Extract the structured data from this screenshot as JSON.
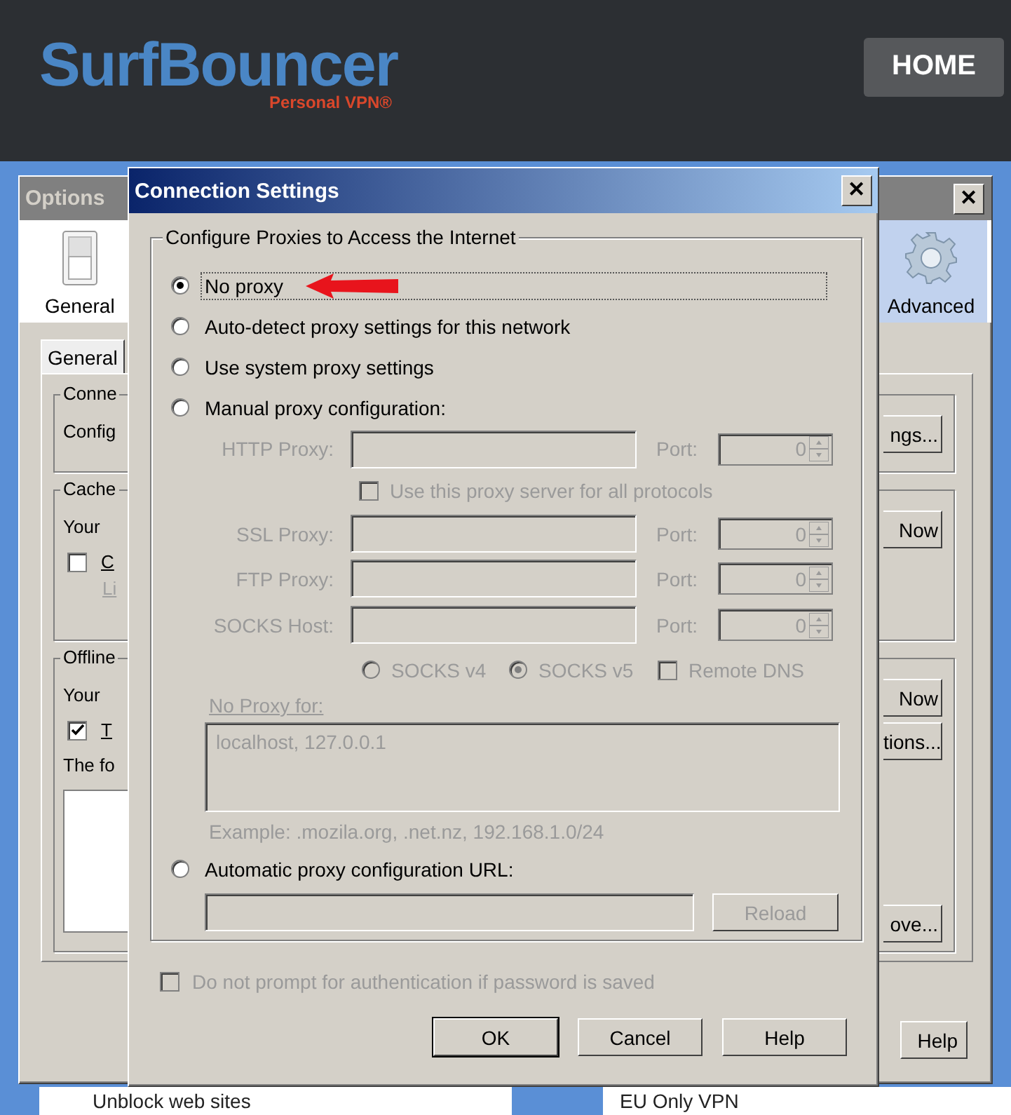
{
  "site": {
    "logo": "SurfBouncer",
    "tagline": "Personal VPN®",
    "home": "HOME"
  },
  "options_window": {
    "title": "Options",
    "close": "✕",
    "toolbar": [
      {
        "label": "General",
        "kind": "switch",
        "selected": false
      },
      {
        "label": "Advanced",
        "kind": "gear",
        "selected": true
      }
    ],
    "tabs": [
      {
        "label": "General",
        "selected": true
      }
    ],
    "groups": [
      {
        "title": "Conne",
        "lines": [
          {
            "kind": "text",
            "text": "Config"
          }
        ],
        "buttons": [
          "ngs..."
        ]
      },
      {
        "title": "Cache",
        "lines": [
          {
            "kind": "text",
            "text": "Your"
          },
          {
            "kind": "checkbox",
            "text": "C",
            "checked": false
          },
          {
            "kind": "link",
            "text": "Li"
          }
        ],
        "buttons": [
          "Now"
        ]
      },
      {
        "title": "Offline",
        "lines": [
          {
            "kind": "text",
            "text": "Your"
          },
          {
            "kind": "checkbox",
            "text": "T",
            "checked": true
          },
          {
            "kind": "text",
            "text": "The fo"
          },
          {
            "kind": "listbox"
          }
        ],
        "buttons": [
          "Now",
          "tions...",
          "ove..."
        ]
      }
    ],
    "help": "Help"
  },
  "dialog": {
    "title": "Connection Settings",
    "close": "✕",
    "group_title": "Configure Proxies to Access the Internet",
    "modes": [
      {
        "label": "No proxy",
        "selected": true
      },
      {
        "label": "Auto-detect proxy settings for this network",
        "selected": false
      },
      {
        "label": "Use system proxy settings",
        "selected": false
      },
      {
        "label": "Manual proxy configuration:",
        "selected": false
      }
    ],
    "manual": {
      "disabled": true,
      "rows": [
        {
          "label": "HTTP Proxy:",
          "port_label": "Port:",
          "port": "0"
        },
        {
          "label": "SSL Proxy:",
          "port_label": "Port:",
          "port": "0"
        },
        {
          "label": "FTP Proxy:",
          "port_label": "Port:",
          "port": "0"
        },
        {
          "label": "SOCKS Host:",
          "port_label": "Port:",
          "port": "0"
        }
      ],
      "use_for_all": {
        "label": "Use this proxy server for all protocols",
        "checked": false
      },
      "socks_versions": [
        {
          "label": "SOCKS v4",
          "selected": false
        },
        {
          "label": "SOCKS v5",
          "selected": true
        }
      ],
      "remote_dns": {
        "label": "Remote DNS",
        "checked": false
      },
      "no_proxy_label": "No Proxy for:",
      "no_proxy_value": "localhost, 127.0.0.1",
      "example": "Example: .mozila.org, .net.nz, 192.168.1.0/24"
    },
    "auto_url": {
      "label": "Automatic proxy configuration URL:",
      "selected": false,
      "disabled": true,
      "reload": "Reload"
    },
    "auth": {
      "label": "Do not prompt for authentication if password is saved",
      "checked": false,
      "disabled": true
    },
    "buttons": [
      "OK",
      "Cancel",
      "Help"
    ]
  },
  "footer_links": [
    "Unblock web sites",
    "EU Only VPN"
  ]
}
